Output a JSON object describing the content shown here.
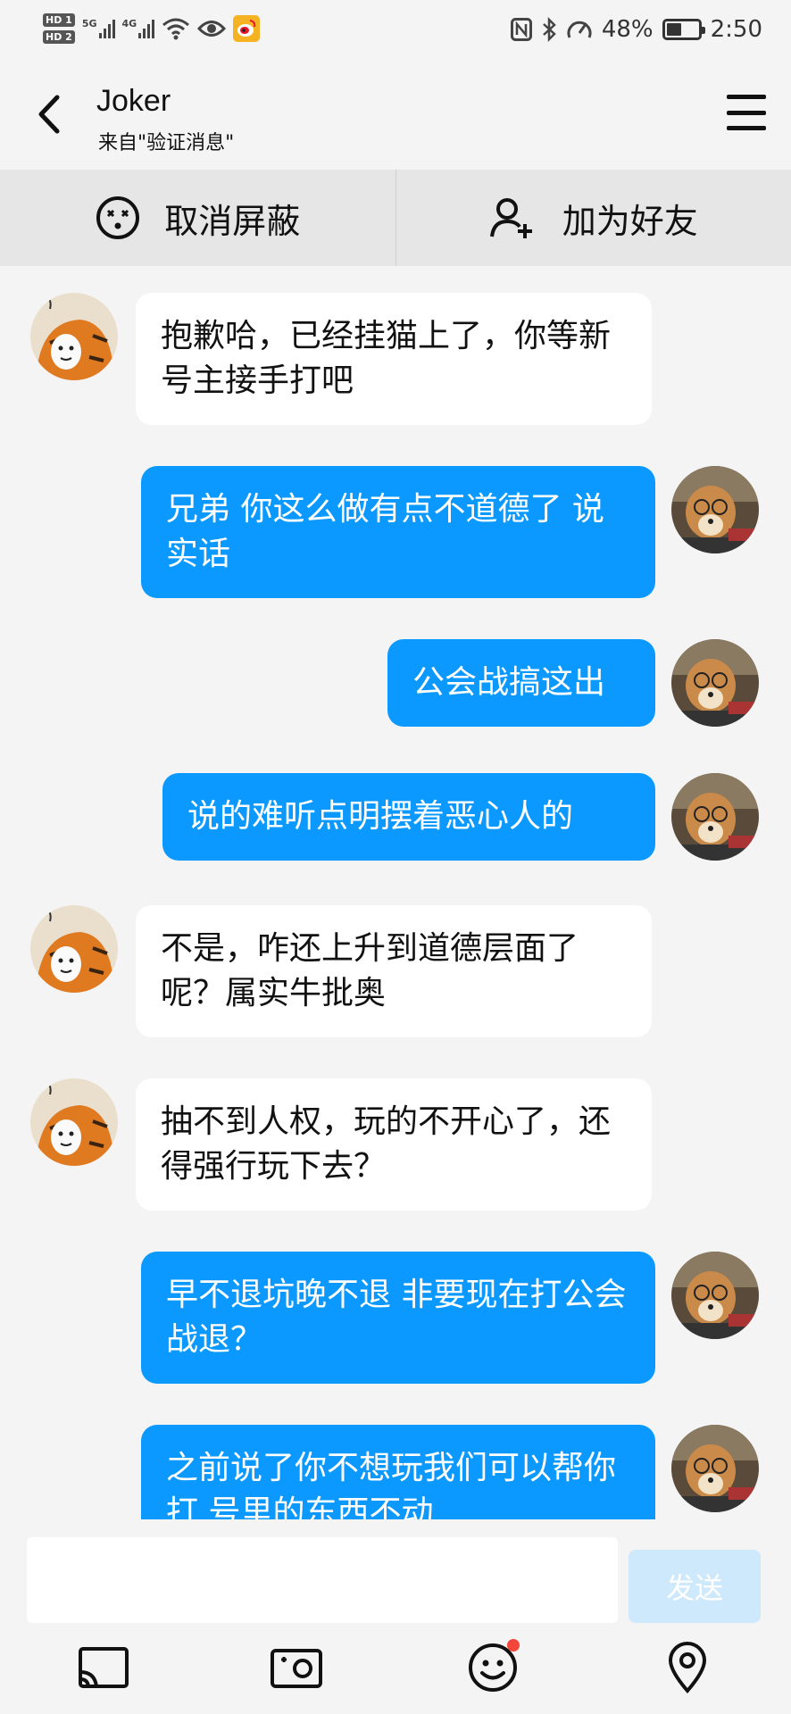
{
  "status_bar": {
    "sim1_tag": "HD 1",
    "sim2_tag": "HD 2",
    "net1_label": "5G",
    "net2_label": "4G",
    "battery_text": "48%",
    "battery_level": 0.48,
    "time": "2:50"
  },
  "header": {
    "title": "Joker",
    "subtitle": "来自\"验证消息\""
  },
  "actions": {
    "unblock_label": "取消屏蔽",
    "add_friend_label": "加为好友"
  },
  "messages": [
    {
      "side": "in",
      "text": "抱歉哈，已经挂猫上了，你等新号主接手打吧"
    },
    {
      "side": "out",
      "text": "兄弟 你这么做有点不道德了 说实话"
    },
    {
      "side": "out",
      "text": "公会战搞这出"
    },
    {
      "side": "out",
      "text": "说的难听点明摆着恶心人的"
    },
    {
      "side": "in",
      "text": "不是，咋还上升到道德层面了呢？属实牛批奥"
    },
    {
      "side": "in",
      "text": "抽不到人权，玩的不开心了，还得强行玩下去？"
    },
    {
      "side": "out",
      "text": "早不退坑晚不退 非要现在打公会战退？"
    },
    {
      "side": "out",
      "text": "之前说了你不想玩我们可以帮你打 号里的东西不动"
    }
  ],
  "input": {
    "value": "",
    "send_label": "发送"
  },
  "colors": {
    "outgoing_bubble": "#0b99ff",
    "incoming_bubble": "#ffffff",
    "send_button_disabled": "#cfe9fc",
    "notification_dot": "#f4453a"
  },
  "toolbar": {
    "icons": [
      "screen-cast-icon",
      "camera-icon",
      "emoji-icon",
      "location-icon"
    ]
  }
}
